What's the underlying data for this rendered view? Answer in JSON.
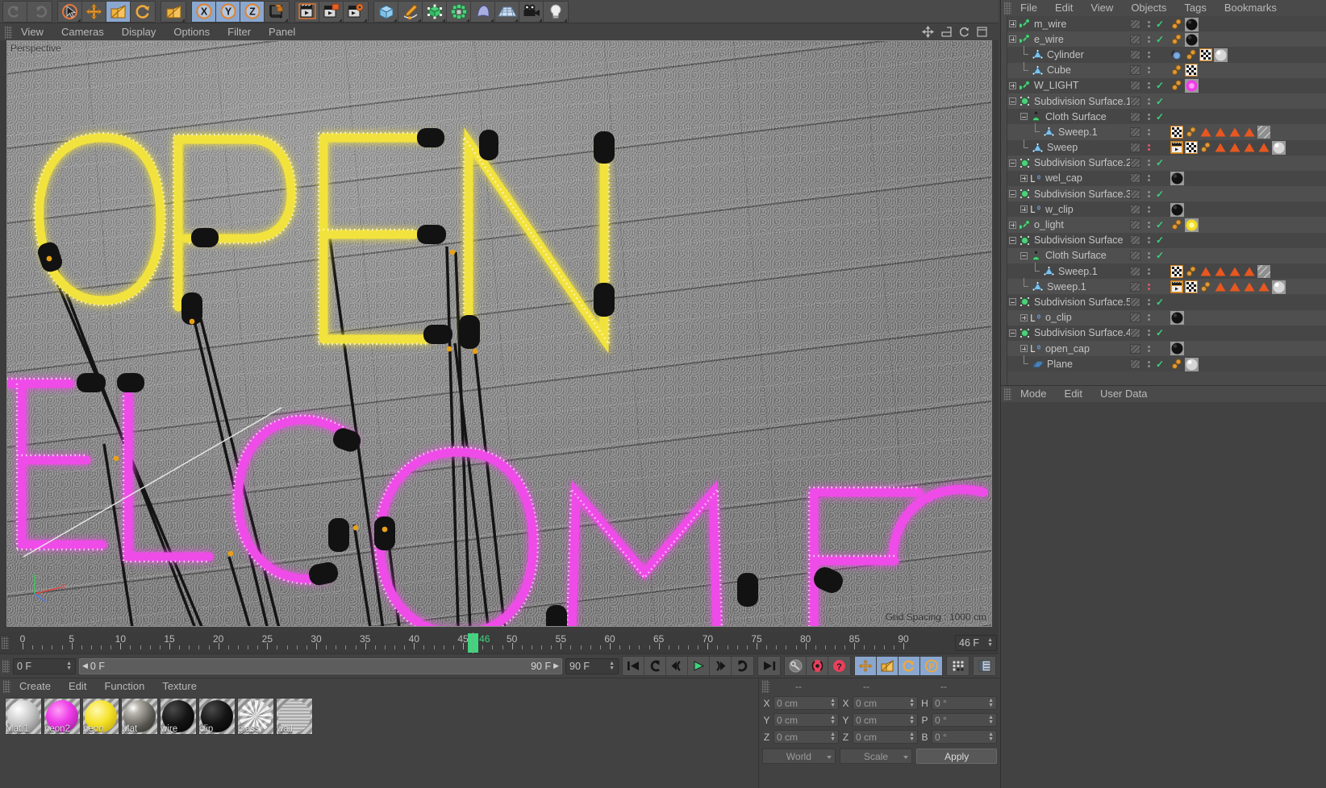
{
  "app": {
    "title": "Cinema 4D"
  },
  "top_toolbar": {
    "groups": [
      {
        "name": "undo-group",
        "buttons": [
          {
            "name": "undo-icon",
            "active": false
          },
          {
            "name": "redo-icon",
            "active": false
          }
        ]
      },
      {
        "name": "tools-group",
        "buttons": [
          {
            "name": "live-selection-icon",
            "active": false
          },
          {
            "name": "move-icon",
            "active": false
          },
          {
            "name": "scale-icon",
            "active": true
          },
          {
            "name": "rotate-icon",
            "active": false
          }
        ]
      },
      {
        "name": "scale-tool-group",
        "buttons": [
          {
            "name": "scale-tool-icon",
            "active": false
          }
        ]
      },
      {
        "name": "axis-lock-group",
        "buttons": [
          {
            "name": "lock-x-icon",
            "label": "X",
            "active": true
          },
          {
            "name": "lock-y-icon",
            "label": "Y",
            "active": true
          },
          {
            "name": "lock-z-icon",
            "label": "Z",
            "active": true
          },
          {
            "name": "world-coordinates-icon",
            "active": false
          }
        ]
      },
      {
        "name": "render-group",
        "buttons": [
          {
            "name": "render-view-icon",
            "active": false
          },
          {
            "name": "render-region-icon",
            "active": false
          },
          {
            "name": "render-settings-icon",
            "active": false
          }
        ]
      },
      {
        "name": "create-group",
        "buttons": [
          {
            "name": "cube-primitive-icon",
            "active": false
          },
          {
            "name": "spline-pen-icon",
            "active": false
          },
          {
            "name": "generator-icon",
            "active": false
          },
          {
            "name": "deformer-icon",
            "active": false
          },
          {
            "name": "nurbs-icon",
            "active": false
          },
          {
            "name": "floor-environment-icon",
            "active": false
          },
          {
            "name": "camera-icon",
            "active": false
          },
          {
            "name": "light-icon",
            "active": false
          }
        ]
      }
    ]
  },
  "viewport": {
    "menu": [
      "View",
      "Cameras",
      "Display",
      "Options",
      "Filter",
      "Panel"
    ],
    "label": "Perspective",
    "grid_spacing": "Grid Spacing : 1000 cm",
    "neon_text_top": "OPEN",
    "neon_text_bottom": "ELCOME",
    "neon_top_color": "#f2e23c",
    "neon_bottom_color": "#ef4ce8",
    "wall_color": "#8f8f8f",
    "nav_icons": [
      "move-view-icon",
      "scale-view-icon",
      "rotate-view-icon",
      "maximize-view-icon"
    ]
  },
  "object_manager": {
    "menu": [
      "File",
      "Edit",
      "View",
      "Objects",
      "Tags",
      "Bookmarks"
    ],
    "rows": [
      {
        "label": "m_wire",
        "depth": 0,
        "expander": "plus",
        "icon": "null-object-icon",
        "visible_check": true,
        "dots": "grey",
        "tags": [
          "orange-pair",
          "black-sphere"
        ]
      },
      {
        "label": "e_wire",
        "depth": 0,
        "expander": "plus",
        "icon": "null-object-icon",
        "visible_check": true,
        "dots": "grey",
        "tags": [
          "orange-pair",
          "black-sphere"
        ]
      },
      {
        "label": "Cylinder",
        "depth": 1,
        "expander": "line",
        "icon": "polygon-object-icon",
        "visible_check": false,
        "dots": "grey",
        "tags": [
          "blue-sphere",
          "orange-pair",
          "checker",
          "grey-sphere"
        ]
      },
      {
        "label": "Cube",
        "depth": 1,
        "expander": "line",
        "icon": "polygon-object-icon",
        "visible_check": false,
        "dots": "grey",
        "tags": [
          "orange-pair",
          "checker"
        ]
      },
      {
        "label": "W_LIGHT",
        "depth": 0,
        "expander": "plus",
        "icon": "null-object-icon",
        "visible_check": true,
        "dots": "grey",
        "tags": [
          "orange-pair",
          "magenta-sphere"
        ]
      },
      {
        "label": "Subdivision Surface.1",
        "depth": 0,
        "expander": "minus",
        "icon": "subdivision-surface-icon",
        "visible_check": true,
        "dots": "grey",
        "tags": []
      },
      {
        "label": "Cloth Surface",
        "depth": 1,
        "expander": "minus",
        "icon": "cloth-surface-icon",
        "visible_check": true,
        "dots": "grey",
        "tags": []
      },
      {
        "label": "Sweep.1",
        "depth": 2,
        "expander": "corner",
        "icon": "polygon-object-icon",
        "visible_check": false,
        "dots": "grey",
        "tags": [
          "checker",
          "orange-pair",
          "tri",
          "tri",
          "tri",
          "tri",
          "hatch"
        ]
      },
      {
        "label": "Sweep",
        "depth": 1,
        "expander": "line",
        "icon": "polygon-object-icon",
        "visible_check": false,
        "dots": "red",
        "tags": [
          "clapper",
          "checker",
          "orange-pair",
          "tri",
          "tri",
          "tri",
          "tri",
          "grey-sphere"
        ]
      },
      {
        "label": "Subdivision Surface.2",
        "depth": 0,
        "expander": "minus",
        "icon": "subdivision-surface-icon",
        "visible_check": true,
        "dots": "grey",
        "tags": []
      },
      {
        "label": "wel_cap",
        "depth": 1,
        "expander": "plus",
        "icon": "layer-zero-icon",
        "visible_check": false,
        "dots": "grey",
        "tags": [
          "black-sphere"
        ]
      },
      {
        "label": "Subdivision Surface.3",
        "depth": 0,
        "expander": "minus",
        "icon": "subdivision-surface-icon",
        "visible_check": true,
        "dots": "grey",
        "tags": []
      },
      {
        "label": "w_clip",
        "depth": 1,
        "expander": "plus",
        "icon": "layer-zero-icon",
        "visible_check": false,
        "dots": "grey",
        "tags": [
          "black-sphere"
        ]
      },
      {
        "label": "o_light",
        "depth": 0,
        "expander": "plus",
        "icon": "null-object-icon",
        "visible_check": true,
        "dots": "grey",
        "tags": [
          "orange-pair",
          "yellow-sphere"
        ]
      },
      {
        "label": "Subdivision Surface",
        "depth": 0,
        "expander": "minus",
        "icon": "subdivision-surface-icon",
        "visible_check": true,
        "dots": "grey",
        "tags": []
      },
      {
        "label": "Cloth Surface",
        "depth": 1,
        "expander": "minus",
        "icon": "cloth-surface-icon",
        "visible_check": true,
        "dots": "grey",
        "tags": []
      },
      {
        "label": "Sweep.1",
        "depth": 2,
        "expander": "corner",
        "icon": "polygon-object-icon",
        "visible_check": false,
        "dots": "grey",
        "tags": [
          "checker",
          "orange-pair",
          "tri",
          "tri",
          "tri",
          "tri",
          "hatch"
        ]
      },
      {
        "label": "Sweep.1",
        "depth": 1,
        "expander": "line",
        "icon": "polygon-object-icon",
        "visible_check": false,
        "dots": "red",
        "tags": [
          "clapper",
          "checker",
          "orange-pair",
          "tri",
          "tri",
          "tri",
          "tri",
          "grey-sphere"
        ]
      },
      {
        "label": "Subdivision Surface.5",
        "depth": 0,
        "expander": "minus",
        "icon": "subdivision-surface-icon",
        "visible_check": true,
        "dots": "grey",
        "tags": []
      },
      {
        "label": "o_clip",
        "depth": 1,
        "expander": "plus",
        "icon": "layer-zero-icon",
        "visible_check": false,
        "dots": "grey",
        "tags": [
          "black-sphere"
        ]
      },
      {
        "label": "Subdivision Surface.4",
        "depth": 0,
        "expander": "minus",
        "icon": "subdivision-surface-icon",
        "visible_check": true,
        "dots": "grey",
        "tags": []
      },
      {
        "label": "open_cap",
        "depth": 1,
        "expander": "plus",
        "icon": "layer-zero-icon",
        "visible_check": false,
        "dots": "grey",
        "tags": [
          "black-sphere"
        ]
      },
      {
        "label": "Plane",
        "depth": 1,
        "expander": "corner",
        "icon": "plane-object-icon",
        "visible_check": true,
        "dots": "grey",
        "tags": [
          "orange-pair",
          "grey-sphere"
        ]
      }
    ]
  },
  "attribute_manager": {
    "menu": [
      "Mode",
      "Edit",
      "User Data"
    ]
  },
  "timeline": {
    "start": 0,
    "end": 90,
    "current_frame": 46,
    "current_frame_label": "46",
    "tick_labels": [
      0,
      5,
      10,
      15,
      20,
      25,
      30,
      35,
      40,
      45,
      50,
      55,
      60,
      65,
      70,
      75,
      80,
      85,
      90
    ]
  },
  "transport": {
    "current_frame_field": "0 F",
    "range_start": "0 F",
    "range_end": "90 F",
    "max_frame_field": "90 F",
    "frame_display": "46 F",
    "buttons": [
      {
        "name": "go-to-start-button",
        "glyph": "start"
      },
      {
        "name": "previous-keyframe-button",
        "glyph": "prevkey"
      },
      {
        "name": "previous-frame-button",
        "glyph": "prevframe"
      },
      {
        "name": "play-button",
        "glyph": "play"
      },
      {
        "name": "next-frame-button",
        "glyph": "nextframe"
      },
      {
        "name": "next-keyframe-button",
        "glyph": "nextkey"
      },
      {
        "name": "go-to-end-button",
        "glyph": "end"
      }
    ],
    "record_buttons": [
      {
        "name": "autokey-toggle",
        "glyph": "key"
      },
      {
        "name": "record-active-objects-button",
        "glyph": "record"
      },
      {
        "name": "record-help-button",
        "glyph": "question"
      }
    ],
    "key_filter_buttons": [
      {
        "name": "position-key-icon",
        "active": true
      },
      {
        "name": "scale-key-icon",
        "active": true
      },
      {
        "name": "rotation-key-icon",
        "active": true
      },
      {
        "name": "parameter-key-icon",
        "active": true
      },
      {
        "name": "point-level-animation-icon",
        "active": false
      },
      {
        "name": "keyframe-selection-icon",
        "active": false
      }
    ]
  },
  "material_manager": {
    "menu": [
      "Create",
      "Edit",
      "Function",
      "Texture"
    ],
    "materials": [
      {
        "name": "Mat.1",
        "color": "#c9c9c9",
        "kind": "grey"
      },
      {
        "name": "neon2",
        "color": "#ee3ce8",
        "kind": "magenta"
      },
      {
        "name": "neon",
        "color": "#f5e229",
        "kind": "yellow"
      },
      {
        "name": "Mat",
        "color": "#6d6b66",
        "kind": "metal"
      },
      {
        "name": "wire",
        "color": "#151515",
        "kind": "black"
      },
      {
        "name": "clip",
        "color": "#111111",
        "kind": "black"
      },
      {
        "name": "glass",
        "color": "#a8a8a8",
        "kind": "glass"
      },
      {
        "name": "wall",
        "color": "#bdbdbd",
        "kind": "wall"
      }
    ]
  },
  "coordinate_manager": {
    "headers": [
      "--",
      "--",
      "--"
    ],
    "rows": [
      {
        "label_a": "X",
        "value_a": "0 cm",
        "label_b": "X",
        "value_b": "0 cm",
        "label_c": "H",
        "value_c": "0 °"
      },
      {
        "label_a": "Y",
        "value_a": "0 cm",
        "label_b": "Y",
        "value_b": "0 cm",
        "label_c": "P",
        "value_c": "0 °"
      },
      {
        "label_a": "Z",
        "value_a": "0 cm",
        "label_b": "Z",
        "value_b": "0 cm",
        "label_c": "B",
        "value_c": "0 °"
      }
    ],
    "coord_system": "World",
    "size_mode": "Scale",
    "apply_label": "Apply"
  }
}
